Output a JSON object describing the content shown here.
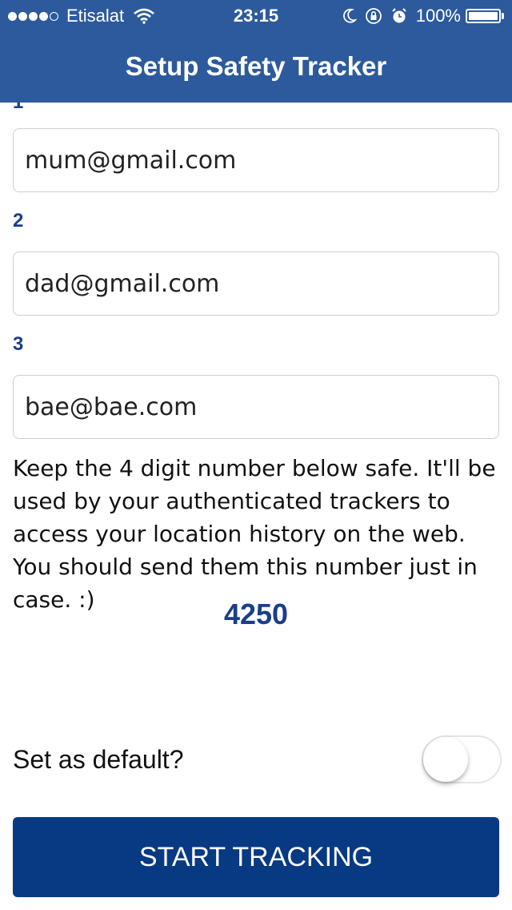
{
  "status_bar": {
    "carrier": "Etisalat",
    "time": "23:15",
    "battery": "100%",
    "signal_bars_filled": 4,
    "signal_bars_total": 5
  },
  "header": {
    "title": "Setup Safety Tracker",
    "background_color": "#2c5a9c"
  },
  "contacts": [
    {
      "label": "1",
      "email": "mum@gmail.com"
    },
    {
      "label": "2",
      "email": "dad@gmail.com"
    },
    {
      "label": "3",
      "email": "bae@bae.com"
    }
  ],
  "info": {
    "message": "Keep the 4 digit number below safe. It'll be used by your authenticated trackers to access your location history on the web. You should send them this number just in case. :)",
    "pin": "4250"
  },
  "default_toggle": {
    "label": "Set as default?",
    "on": false
  },
  "actions": {
    "start_label": "START TRACKING",
    "button_color": "#073a83"
  },
  "icons": [
    "wifi-icon",
    "moon-icon",
    "rotation-lock-icon",
    "alarm-icon",
    "battery-icon"
  ]
}
